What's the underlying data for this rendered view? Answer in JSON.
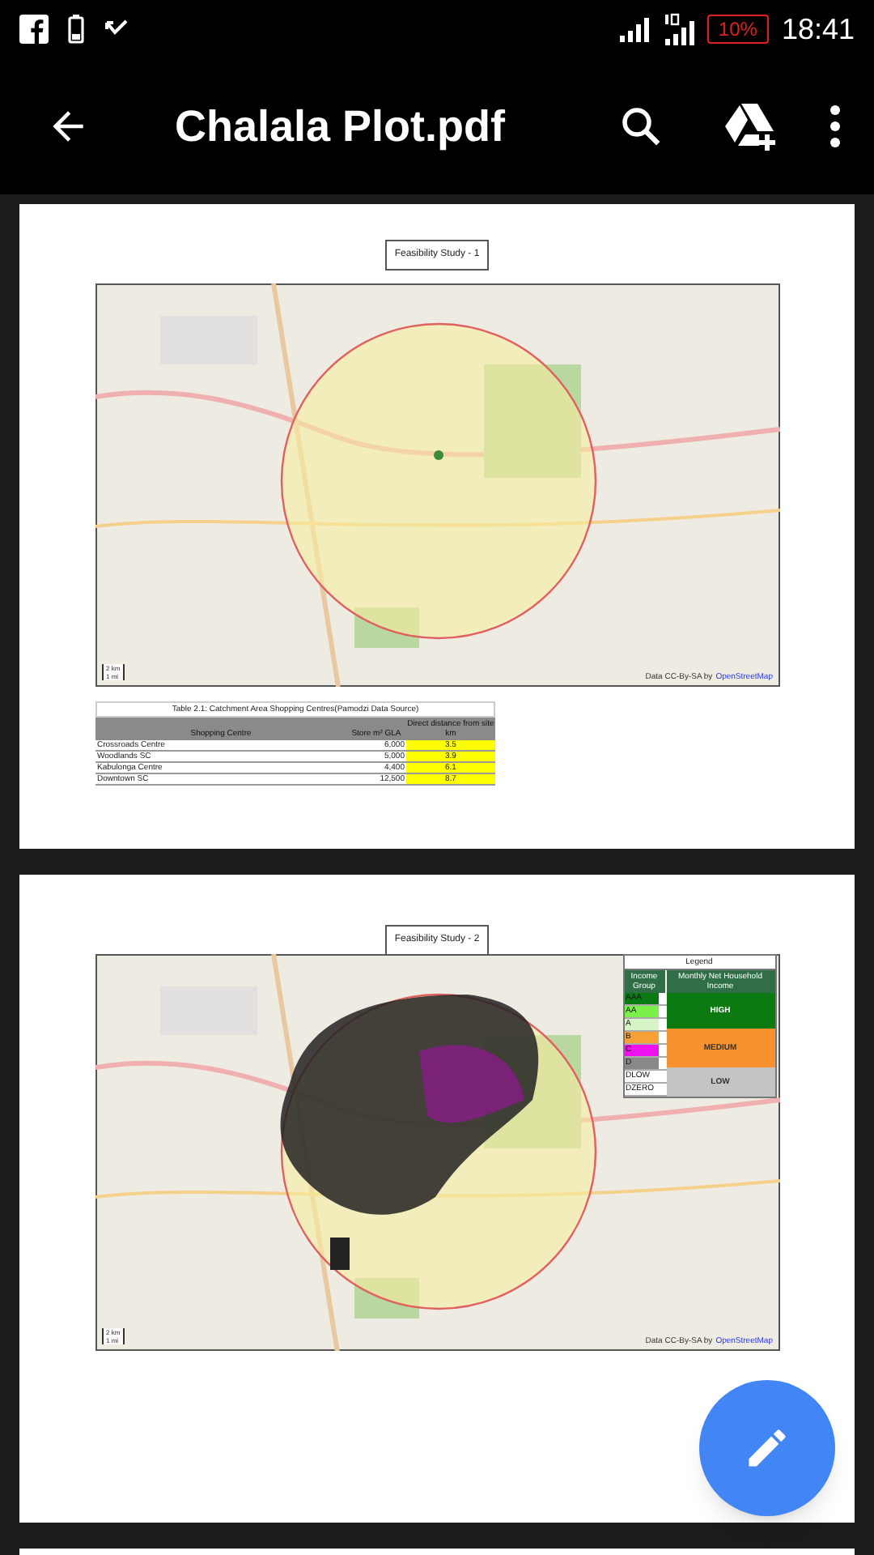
{
  "status_bar": {
    "battery": "10%",
    "time": "18:41"
  },
  "toolbar": {
    "title": "Chalala Plot.pdf"
  },
  "pages": [
    {
      "kind": "catchment",
      "heading": "Feasibility Study - 1",
      "map": {
        "scale": [
          "2 km",
          "1 mi"
        ],
        "attribution": "Data CC-By-SA by",
        "attribution_link": "OpenStreetMap"
      },
      "table": {
        "caption": "Table 2.1: Catchment Area Shopping Centres(Pamodzi Data Source)",
        "columns": [
          "Shopping Centre",
          "Store m² GLA",
          "Direct distance from site km"
        ],
        "rows": [
          [
            "Crossroads Centre",
            "6,000",
            "3.5"
          ],
          [
            "Woodlands SC",
            "5,000",
            "3.9"
          ],
          [
            "Kabulonga Centre",
            "4,400",
            "6.1"
          ],
          [
            "Downtown SC",
            "12,500",
            "8.7"
          ]
        ]
      }
    },
    {
      "kind": "income",
      "heading": "Feasibility Study - 2",
      "map": {
        "scale": [
          "2 km",
          "1 mi"
        ],
        "attribution": "Data CC-By-SA by",
        "attribution_link": "OpenStreetMap"
      },
      "legend": {
        "title": "Legend",
        "columns": [
          "Income Group",
          "Monthly Net Household Income"
        ],
        "groups": [
          {
            "label": "AAA",
            "color": "#0a7a14"
          },
          {
            "label": "AA",
            "color": "#7cf04a"
          },
          {
            "label": "A",
            "color": "#d8f5c8"
          },
          {
            "label": "B",
            "color": "#f7a035"
          },
          {
            "label": "C",
            "color": "#ee11ee"
          },
          {
            "label": "D",
            "color": "#888888"
          },
          {
            "label": "DLOW",
            "color": "#ffffff"
          },
          {
            "label": "DZERO",
            "color": "#ffffff"
          }
        ],
        "bands": [
          {
            "label": "HIGH",
            "color": "#0b7a10"
          },
          {
            "label": "MEDIUM",
            "color": "#f7922e"
          },
          {
            "label": "LOW",
            "color": "#c4c4c4"
          }
        ]
      }
    }
  ]
}
